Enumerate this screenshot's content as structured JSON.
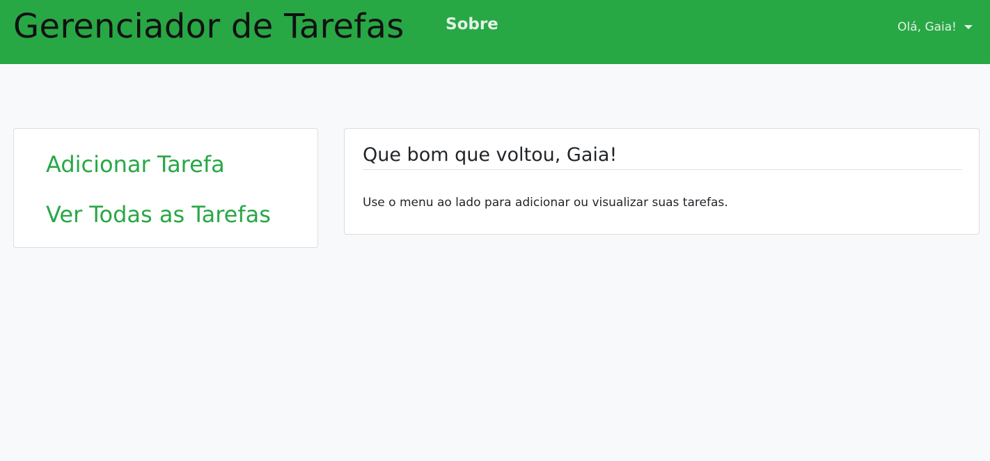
{
  "navbar": {
    "brand": "Gerenciador de Tarefas",
    "about_link": "Sobre",
    "user_menu_label": "Olá, Gaia!",
    "background_color": "#28a745"
  },
  "sidebar": {
    "items": [
      {
        "label": "Adicionar Tarefa"
      },
      {
        "label": "Ver Todas as Tarefas"
      }
    ],
    "link_color": "#28a745"
  },
  "main": {
    "welcome_title": "Que bom que voltou, Gaia!",
    "welcome_text": "Use o menu ao lado para adicionar ou visualizar suas tarefas."
  },
  "icons": {
    "user_menu_caret": "chevron-down-icon"
  }
}
